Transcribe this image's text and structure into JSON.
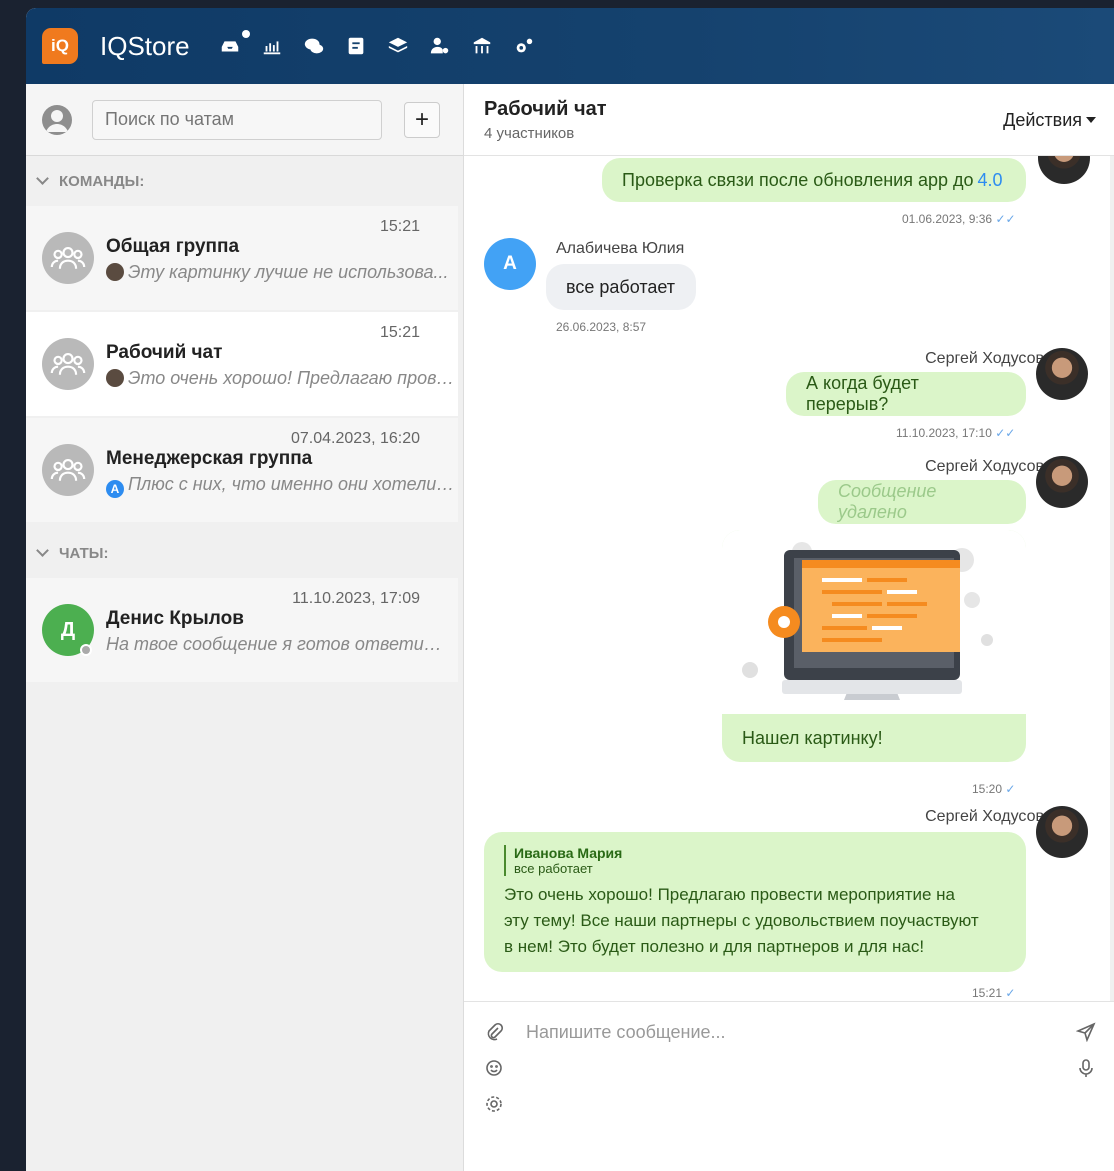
{
  "app": {
    "brand": "IQStore",
    "logo_text": "iQ"
  },
  "nav_icons": [
    "inbox-icon",
    "bar-chart-icon",
    "chat-icon",
    "contacts-icon",
    "layers-icon",
    "user-settings-icon",
    "analytics-icon",
    "gears-icon"
  ],
  "sidebar": {
    "search_placeholder": "Поиск по чатам",
    "add_label": "+",
    "sections": {
      "teams": "КОМАНДЫ:",
      "chats": "ЧАТЫ:"
    },
    "items": [
      {
        "name": "Общая группа",
        "time": "15:21",
        "preview": "Эту картинку лучше не использова..."
      },
      {
        "name": "Рабочий чат",
        "time": "15:21",
        "preview": "Это очень хорошо! Предлагаю прове..."
      },
      {
        "name": "Менеджерская группа",
        "time": "07.04.2023, 16:20",
        "preview": "Плюс с них, что именно они хотели ...",
        "mini_letter": "A"
      },
      {
        "name": "Денис Крылов",
        "time": "11.10.2023, 17:09",
        "preview": "На твое сообщение я готов ответить...",
        "avatar_letter": "Д"
      }
    ]
  },
  "chat": {
    "title": "Рабочий чат",
    "subtitle": "4 участников",
    "actions_label": "Действия",
    "messages": {
      "m1_text_prefix": "Проверка связи после обновления app до ",
      "m1_version": "4.0",
      "m1_time": "01.06.2023, 9:36",
      "m2_sender": "Алабичева Юлия",
      "m2_avatar": "A",
      "m2_text": "все работает",
      "m2_time": "26.06.2023, 8:57",
      "m3_sender": "Сергей Ходусов",
      "m3_text": "А когда будет перерыв?",
      "m3_time": "11.10.2023, 17:10",
      "m4_sender": "Сергей Ходусов",
      "m4_deleted": "Сообщение удалено",
      "m5_caption": "Нашел картинку!",
      "m5_time": "15:20",
      "m6_sender": "Сергей Ходусов",
      "m6_quote_author": "Иванова Мария",
      "m6_quote_text": "все работает",
      "m6_line1": "Это очень хорошо! Предлагаю провести мероприятие на",
      "m6_line2": "эту тему! Все наши партнеры с удовольствием поучаствуют",
      "m6_line3": "в нем! Это будет полезно и для партнеров и для нас!",
      "m6_time": "15:21"
    },
    "composer_placeholder": "Напишите сообщение..."
  },
  "colors": {
    "accent": "#f07a1e",
    "topbar": "#0f3a66",
    "out_bubble": "#dbf5c9",
    "in_bubble": "#eef0f3",
    "link": "#2d8cf0"
  }
}
